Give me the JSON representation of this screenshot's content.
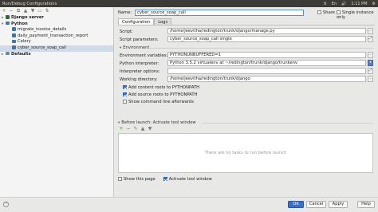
{
  "titlebar": {
    "title": "Run/Debug Configurations",
    "status_items": [
      "⇅",
      "En",
      "🔊",
      "1:11 PM",
      "⚙"
    ]
  },
  "left_toolbar": {
    "icons": [
      "add-icon",
      "remove-icon",
      "copy-icon",
      "up-icon",
      "down-icon",
      "folder-icon",
      "sort-icon"
    ]
  },
  "tree": {
    "nodes": [
      {
        "label": "Django server",
        "level": 0,
        "bold": true,
        "arrow": "▸",
        "icon": "dj"
      },
      {
        "label": "Python",
        "level": 0,
        "bold": true,
        "arrow": "▾",
        "icon": "py"
      },
      {
        "label": "migrate_invoice_details",
        "level": 1,
        "bold": false,
        "arrow": "",
        "icon": "py"
      },
      {
        "label": "daily_payment_transaction_report",
        "level": 1,
        "bold": false,
        "arrow": "",
        "icon": "py"
      },
      {
        "label": "Celery",
        "level": 1,
        "bold": false,
        "arrow": "",
        "icon": "py"
      },
      {
        "label": "cyber_source_soap_call",
        "level": 1,
        "bold": false,
        "arrow": "",
        "icon": "py",
        "selected": true
      },
      {
        "label": "Defaults",
        "level": 0,
        "bold": true,
        "arrow": "▸",
        "icon": "def"
      }
    ]
  },
  "config": {
    "name_label": "Name:",
    "name_value": "cyber_source_soap_call",
    "share_label": "Share",
    "single_instance_label": "Single instance only",
    "tabs": [
      "Configuration",
      "Logs"
    ],
    "script_label": "Script:",
    "script_value": "/home/jeevitha/redington/trunk/django/manage.py",
    "script_params_label": "Script parameters:",
    "script_params_value": "cyber_source_soap_call single",
    "environment_section": "Environment",
    "env_vars_label": "Environment variables:",
    "env_vars_value": "PYTHONUNBUFFERED=1",
    "interpreter_label": "Python interpreter:",
    "interpreter_value": "Python 3.5.2 virtualenv at ~/redington/trunk/django/trunkenv",
    "interp_options_label": "Interpreter options:",
    "interp_options_value": "",
    "working_dir_label": "Working directory:",
    "working_dir_value": "/home/jeevitha/redington/trunk/django",
    "add_content_roots": "Add content roots to PYTHONPATH",
    "add_source_roots": "Add source roots to PYTHONPATH",
    "show_cmd_line": "Show command line afterwards",
    "before_launch_section": "Before launch: Activate tool window",
    "before_launch_empty": "There are no tasks to run before launch",
    "show_this_page": "Show this page",
    "activate_tool_window": "Activate tool window"
  },
  "footer": {
    "ok": "OK",
    "cancel": "Cancel",
    "apply": "Apply",
    "help": "Help",
    "help_icon": "?"
  }
}
